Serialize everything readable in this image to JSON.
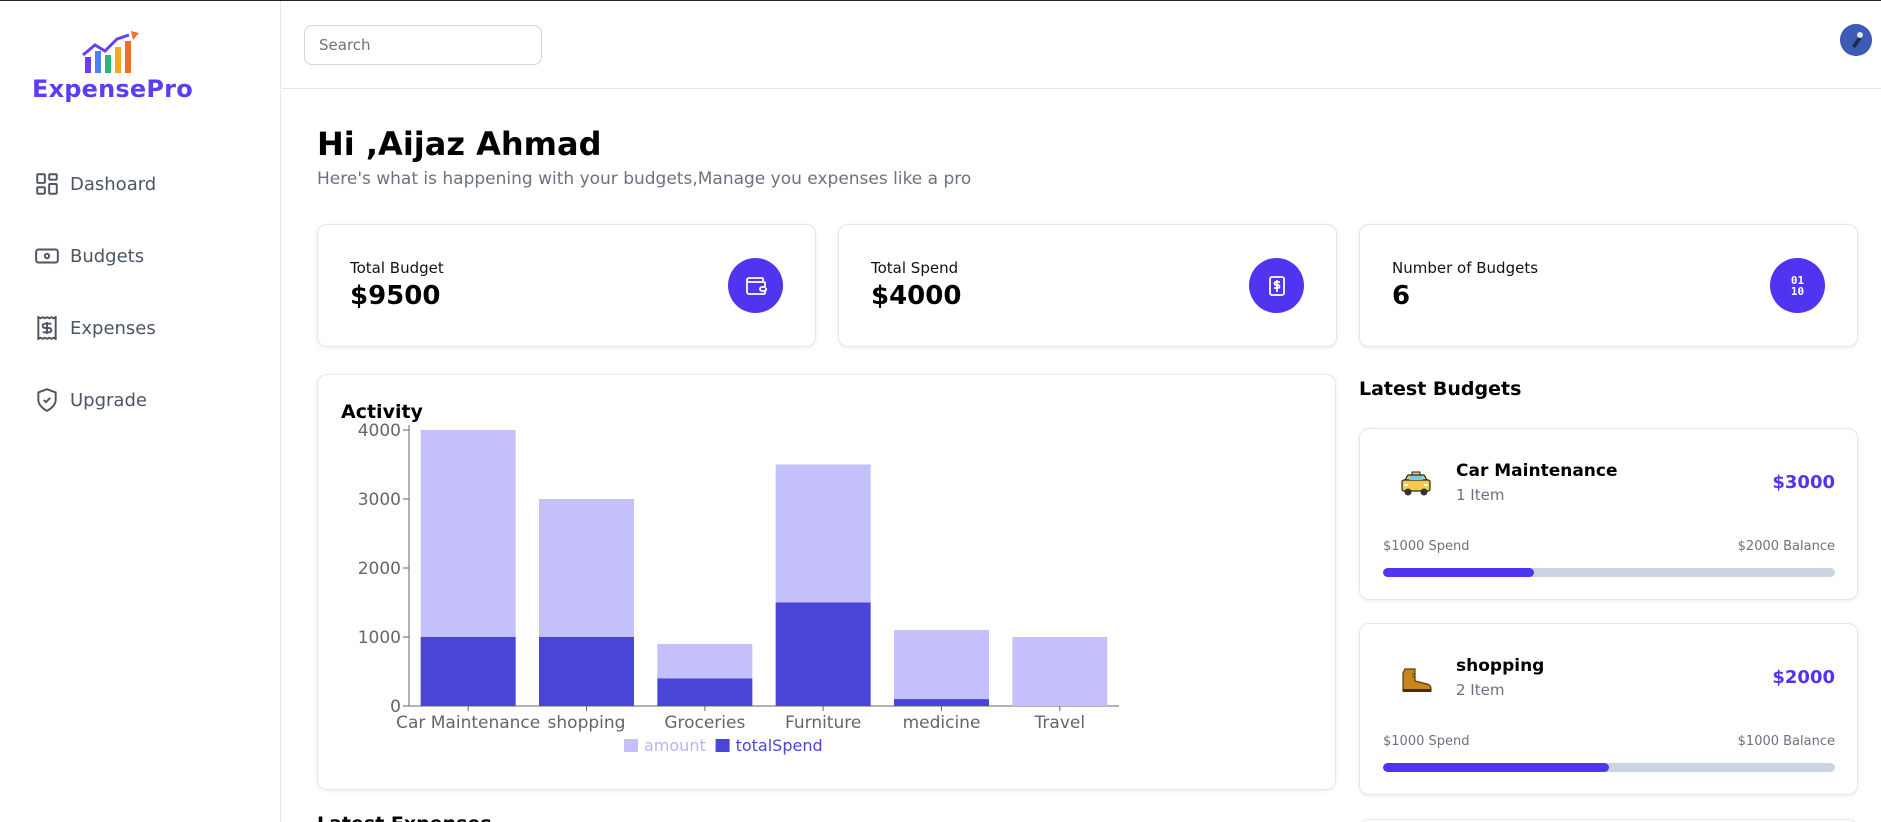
{
  "app": {
    "name": "ExpensePro",
    "brand_color": "#5b3df5"
  },
  "sidebar": {
    "items": [
      {
        "label": "Dashoard",
        "icon": "grid-icon"
      },
      {
        "label": "Budgets",
        "icon": "wallet-icon"
      },
      {
        "label": "Expenses",
        "icon": "receipt-dollar-icon"
      },
      {
        "label": "Upgrade",
        "icon": "shield-check-icon"
      }
    ]
  },
  "header": {
    "search_placeholder": "Search"
  },
  "greeting": {
    "title": "Hi ,Aijaz Ahmad",
    "subtitle": "Here's what is happening with your budgets,Manage you expenses like a pro"
  },
  "stats": [
    {
      "label": "Total Budget",
      "value": "$9500",
      "icon": "wallet-icon"
    },
    {
      "label": "Total Spend",
      "value": "$4000",
      "icon": "dollar-receipt-icon"
    },
    {
      "label": "Number of Budgets",
      "value": "6",
      "icon": "binary-icon"
    }
  ],
  "activity": {
    "title": "Activity"
  },
  "chart_data": {
    "type": "bar",
    "categories": [
      "Car Maintenance",
      "shopping",
      "Groceries",
      "Furniture",
      "medicine",
      "Travel"
    ],
    "series": [
      {
        "name": "amount",
        "values": [
          3000,
          2000,
          500,
          2000,
          1000,
          1000
        ],
        "color": "#c3c0fb"
      },
      {
        "name": "totalSpend",
        "values": [
          1000,
          1000,
          400,
          1500,
          100,
          0
        ],
        "color": "#4a45d6"
      }
    ],
    "stacked": true,
    "yticks": [
      0,
      1000,
      2000,
      3000,
      4000
    ],
    "ylim": [
      0,
      4000
    ],
    "legend": "bottom"
  },
  "latest_budgets": {
    "title": "Latest Budgets",
    "items": [
      {
        "name": "Car Maintenance",
        "items_text": "1 Item",
        "amount": "$3000",
        "spend": "$1000 Spend",
        "balance": "$2000 Balance",
        "progress": 0.333,
        "icon": "taxi-emoji"
      },
      {
        "name": "shopping",
        "items_text": "2 Item",
        "amount": "$2000",
        "spend": "$1000 Spend",
        "balance": "$1000 Balance",
        "progress": 0.5,
        "icon": "boot-emoji"
      }
    ]
  },
  "latest_expenses": {
    "title": "Latest Expenses"
  }
}
